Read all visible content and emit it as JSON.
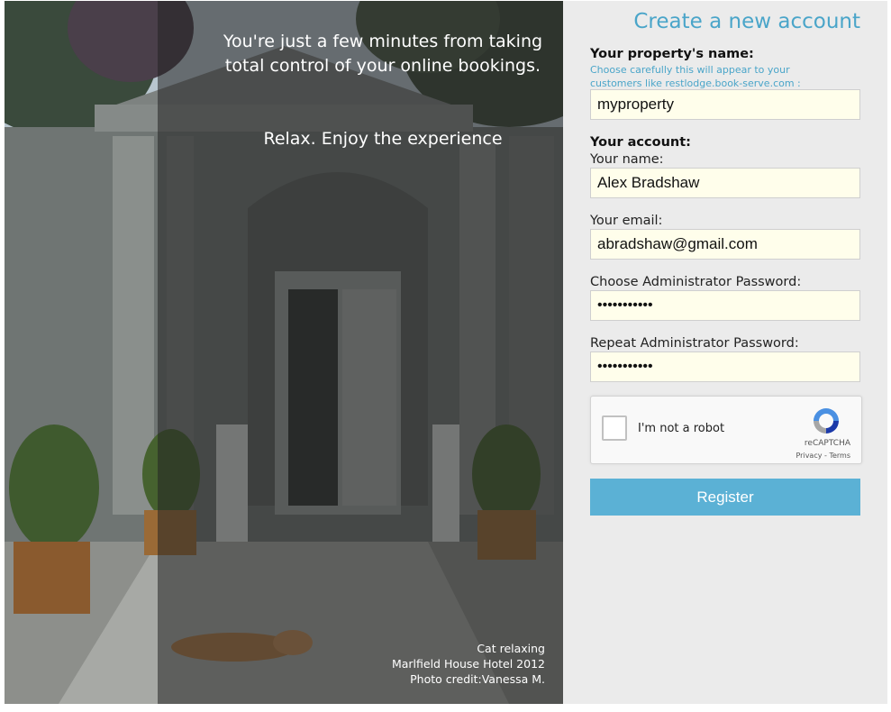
{
  "hero": {
    "tagline": "You're just a few minutes from taking total control of your online bookings.",
    "subtagline": "Relax. Enjoy the experience",
    "credit": [
      "Cat relaxing",
      "Marlfield House Hotel 2012",
      "Photo credit:Vanessa M."
    ]
  },
  "form": {
    "title": "Create a new account",
    "property_label": "Your property's name:",
    "property_hint": "Choose carefully this will appear to your customers like restlodge.book-serve.com :",
    "property_value": "myproperty",
    "account_heading": "Your account:",
    "name_label": "Your name:",
    "name_value": "Alex Bradshaw",
    "email_label": "Your email:",
    "email_value": "abradshaw@gmail.com",
    "password_label": "Choose Administrator Password:",
    "password_value": "•••••••••••",
    "repeat_password_label": "Repeat Administrator Password:",
    "repeat_password_value": "•••••••••••",
    "captcha": {
      "label": "I'm not a robot",
      "brand": "reCAPTCHA",
      "links": "Privacy - Terms",
      "checked": false
    },
    "register_label": "Register"
  },
  "colors": {
    "accent": "#4aa5c9",
    "button": "#5bb1d5",
    "form_bg": "#ebebeb",
    "field_bg": "#fffeeb"
  }
}
